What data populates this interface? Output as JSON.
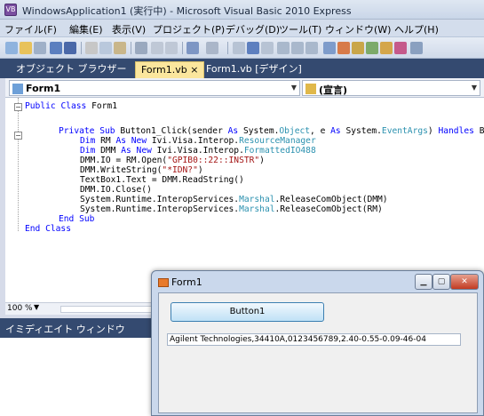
{
  "window": {
    "title": "WindowsApplication1 (実行中) - Microsoft Visual Basic 2010 Express",
    "app_icon": "vb-icon"
  },
  "menu": [
    "ファイル(F)",
    "編集(E)",
    "表示(V)",
    "プロジェクト(P)",
    "デバッグ(D)",
    "ツール(T)",
    "ウィンドウ(W)",
    "ヘルプ(H)"
  ],
  "tabs": [
    {
      "label": "オブジェクト ブラウザー",
      "active": false
    },
    {
      "label": "Form1.vb ×",
      "active": true
    },
    {
      "label": "Form1.vb [デザイン]",
      "active": false
    }
  ],
  "editor": {
    "class_combo": "Form1",
    "member_combo": "(宣言)",
    "code": {
      "l1": [
        "Public ",
        "Class ",
        "Form1"
      ],
      "l2": {
        "a": "Private ",
        "b": "Sub ",
        "c": "Button1_Click(sender ",
        "d": "As ",
        "e": "System.",
        "f": "Object",
        "g": ", e ",
        "h": "As ",
        "i": "System.",
        "j": "EventArgs",
        "k": ") ",
        "l": "Handles ",
        "m": "Bu"
      },
      "l3": {
        "a": "Dim ",
        "b": "RM ",
        "c": "As New ",
        "d": "Ivi.Visa.Interop.",
        "e": "ResourceManager"
      },
      "l4": {
        "a": "Dim ",
        "b": "DMM ",
        "c": "As New ",
        "d": "Ivi.Visa.Interop.",
        "e": "FormattedIO488"
      },
      "l5": {
        "a": "DMM.IO = RM.Open(",
        "b": "\"GPIB0::22::INSTR\"",
        "c": ")"
      },
      "l6": {
        "a": "DMM.WriteString(",
        "b": "\"*IDN?\"",
        "c": ")"
      },
      "l7": "TextBox1.Text = DMM.ReadString()",
      "l8": "DMM.IO.Close()",
      "l9": {
        "a": "System.Runtime.InteropServices.",
        "b": "Marshal",
        "c": ".ReleaseComObject(DMM)"
      },
      "l10": {
        "a": "System.Runtime.InteropServices.",
        "b": "Marshal",
        "c": ".ReleaseComObject(RM)"
      },
      "l11": "End Sub",
      "l12": "End Class"
    },
    "zoom": "100 %"
  },
  "immediate": {
    "title": "イミディエイト ウィンドウ"
  },
  "form": {
    "title": "Form1",
    "button_label": "Button1",
    "textbox_value": "Agilent Technologies,34410A,0123456789,2.40-0.55-0.09-46-04"
  },
  "colors": {
    "keyword": "#0000ff",
    "type": "#2b91af",
    "string": "#a31515",
    "tab_active": "#fbe69d",
    "tab_strip": "#344a70"
  }
}
